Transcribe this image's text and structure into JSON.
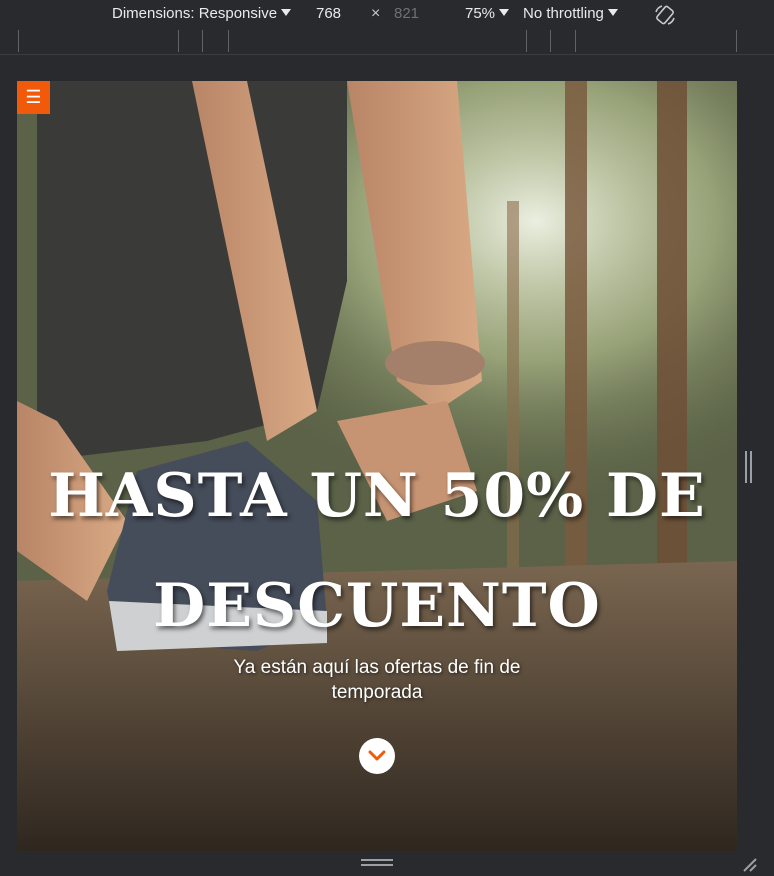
{
  "toolbar": {
    "dimensions_label": "Dimensions: Responsive",
    "width": "768",
    "times": "×",
    "height": "821",
    "zoom": "75%",
    "throttling": "No throttling",
    "rotate_icon": "rotate-icon"
  },
  "page": {
    "menu_icon": "☰",
    "hero": {
      "title_line1": "HASTA UN 50% DE",
      "title_line2": "DESCUENTO",
      "subtitle": "Ya están aquí las ofertas de fin de temporada",
      "scroll_icon": "chevron-down-icon"
    }
  },
  "colors": {
    "accent": "#f15a0a",
    "toolbar_bg": "#292a2d",
    "hero_text": "#ffffff"
  }
}
